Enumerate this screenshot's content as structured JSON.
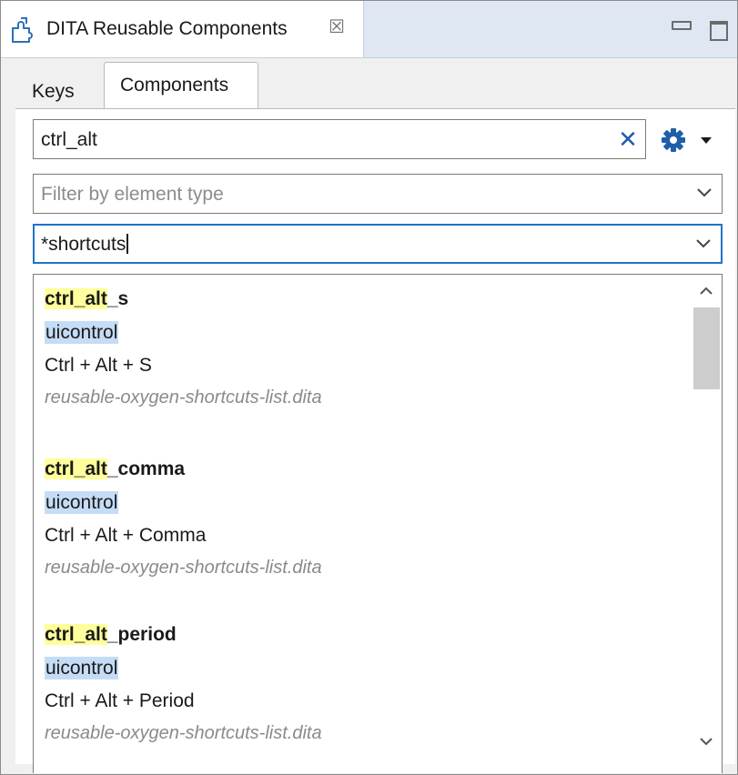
{
  "view": {
    "title": "DITA Reusable Components",
    "close_glyph": "☒"
  },
  "tabs": [
    {
      "label": "Keys",
      "selected": false
    },
    {
      "label": "Components",
      "selected": true
    }
  ],
  "search": {
    "value": "ctrl_alt",
    "clear_glyph": "✕"
  },
  "filters": {
    "element_type_placeholder": "Filter by element type",
    "file_value": "*shortcuts"
  },
  "results": [
    {
      "key_match": "ctrl_alt",
      "key_rest": "_s",
      "element": "uicontrol",
      "value": "Ctrl + Alt + S",
      "file": "reusable-oxygen-shortcuts-list.dita"
    },
    {
      "key_match": "ctrl_alt",
      "key_rest": "_comma",
      "element": "uicontrol",
      "value": "Ctrl + Alt + Comma",
      "file": "reusable-oxygen-shortcuts-list.dita"
    },
    {
      "key_match": "ctrl_alt",
      "key_rest": "_period",
      "element": "uicontrol",
      "value": "Ctrl + Alt + Period",
      "file": "reusable-oxygen-shortcuts-list.dita"
    }
  ],
  "colors": {
    "accent": "#1f74c8",
    "match_highlight": "#ffff9c",
    "element_highlight": "#c5dcf6"
  },
  "icons": [
    "puzzle-piece-icon",
    "close-icon",
    "minimize-icon",
    "maximize-icon",
    "clear-icon",
    "gear-icon",
    "dropdown-arrow-icon",
    "chevron-down-icon",
    "scroll-up-icon",
    "scroll-down-icon"
  ]
}
